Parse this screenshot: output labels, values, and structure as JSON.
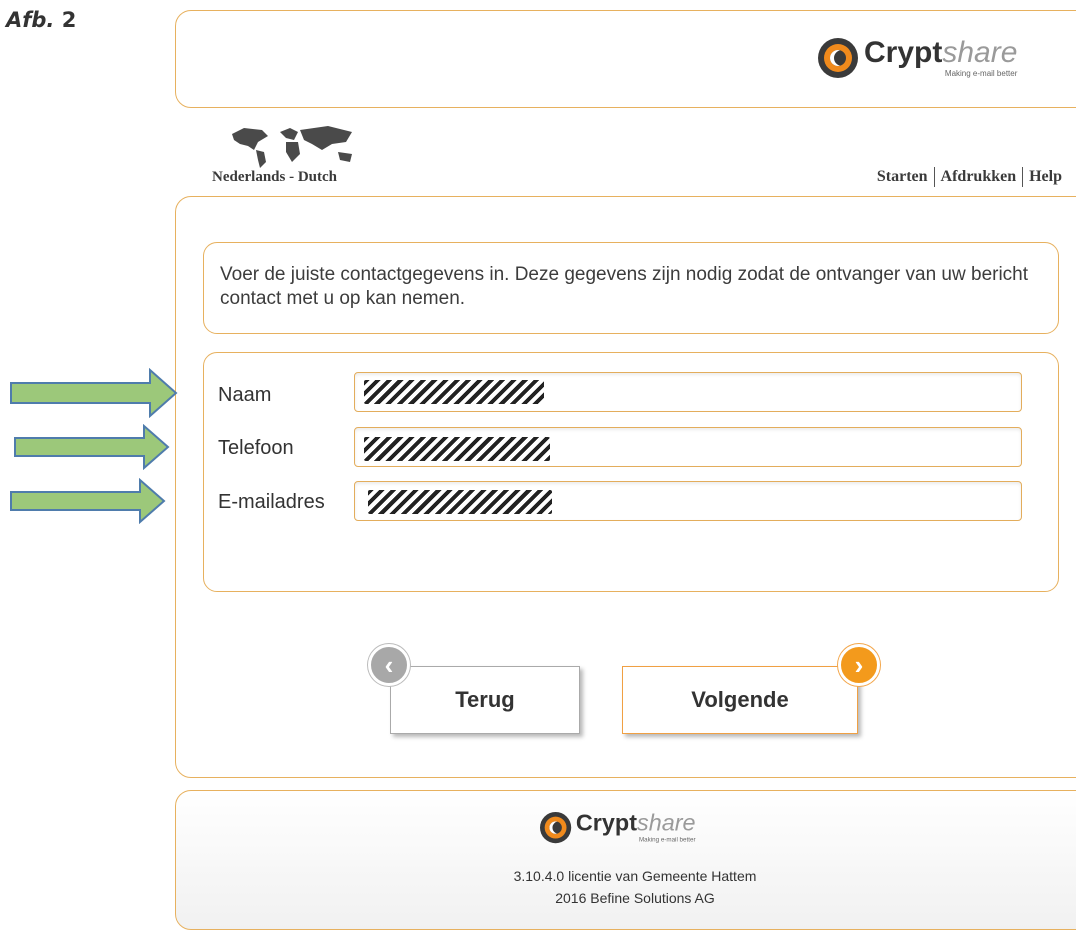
{
  "figure": {
    "label_italic": "Afb.",
    "label_number": "2"
  },
  "brand": {
    "name_bold": "Crypt",
    "name_light": "share",
    "tagline": "Making e-mail better"
  },
  "language": {
    "current": "Nederlands - Dutch"
  },
  "nav": {
    "items": [
      "Starten",
      "Afdrukken",
      "Help"
    ]
  },
  "intro": {
    "text": "Voer de juiste contactgegevens in. Deze gegevens zijn nodig zodat de ontvanger van uw bericht contact met u op kan nemen."
  },
  "form": {
    "name_label": "Naam",
    "phone_label": "Telefoon",
    "email_label": "E-mailadres"
  },
  "buttons": {
    "back": "Terug",
    "next": "Volgende"
  },
  "footer": {
    "license": "3.10.4.0 licentie van Gemeente Hattem",
    "copyright": "2016 Befine Solutions AG"
  },
  "colors": {
    "accent": "#f39a1c",
    "border": "#e7b15f",
    "arrow": "#9cc87a"
  }
}
